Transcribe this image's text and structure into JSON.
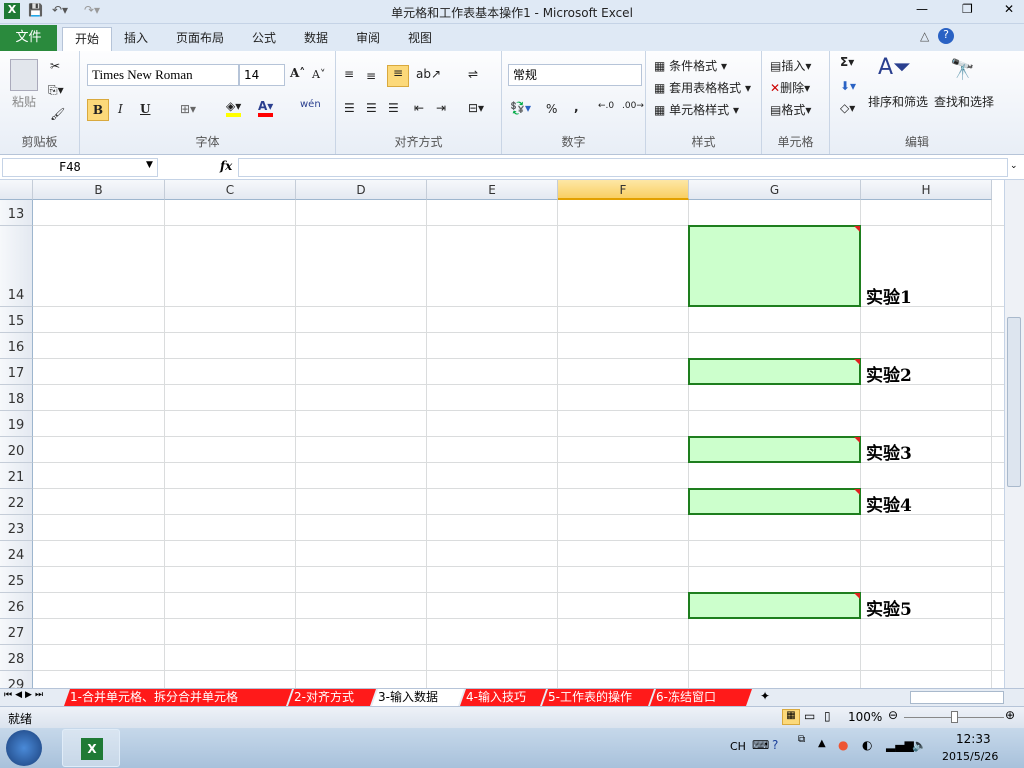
{
  "window": {
    "title": "单元格和工作表基本操作1 - Microsoft Excel"
  },
  "ribbon_tabs": [
    "文件",
    "开始",
    "插入",
    "页面布局",
    "公式",
    "数据",
    "审阅",
    "视图"
  ],
  "ribbon": {
    "clipboard": {
      "label": "剪贴板",
      "paste": "粘贴"
    },
    "font": {
      "label": "字体",
      "name": "Times New Roman",
      "size": "14",
      "bold": "B",
      "italic": "I",
      "underline": "U",
      "phonetic": "wén"
    },
    "alignment": {
      "label": "对齐方式"
    },
    "number": {
      "label": "数字",
      "format": "常规",
      "percent": "%",
      "comma": ","
    },
    "styles": {
      "label": "样式",
      "items": [
        "条件格式",
        "套用表格格式",
        "单元格样式"
      ]
    },
    "cells": {
      "label": "单元格",
      "items": [
        "插入",
        "删除",
        "格式"
      ]
    },
    "editing": {
      "label": "编辑",
      "sort": "排序和筛选",
      "find": "查找和选择"
    }
  },
  "formula_bar": {
    "name_box": "F48",
    "fx": "fx",
    "value": ""
  },
  "columns": [
    "B",
    "C",
    "D",
    "E",
    "F",
    "G",
    "H"
  ],
  "selected_column": "F",
  "rows": [
    "13",
    "14",
    "15",
    "16",
    "17",
    "18",
    "19",
    "20",
    "21",
    "22",
    "23",
    "24",
    "25",
    "26",
    "27",
    "28",
    "29"
  ],
  "cells": [
    {
      "row": "14",
      "label": "实验1"
    },
    {
      "row": "17",
      "label": "实验2"
    },
    {
      "row": "20",
      "label": "实验3"
    },
    {
      "row": "22",
      "label": "实验4"
    },
    {
      "row": "26",
      "label": "实验5"
    }
  ],
  "sheets": [
    "1-合并单元格、拆分合并单元格",
    "2-对齐方式",
    "3-输入数据",
    "4-输入技巧",
    "5-工作表的操作",
    "6-冻结窗口"
  ],
  "active_sheet": "3-输入数据",
  "status": {
    "ready": "就绪",
    "zoom": "100%"
  },
  "taskbar": {
    "lang": "CH",
    "time": "12:33",
    "date": "2015/5/26"
  },
  "colors": {
    "cell_fill": "#ccffcc",
    "cell_border": "#1e7e1e",
    "sheet_tab": "#ff1a1a",
    "file_tab": "#2a8a3d"
  }
}
